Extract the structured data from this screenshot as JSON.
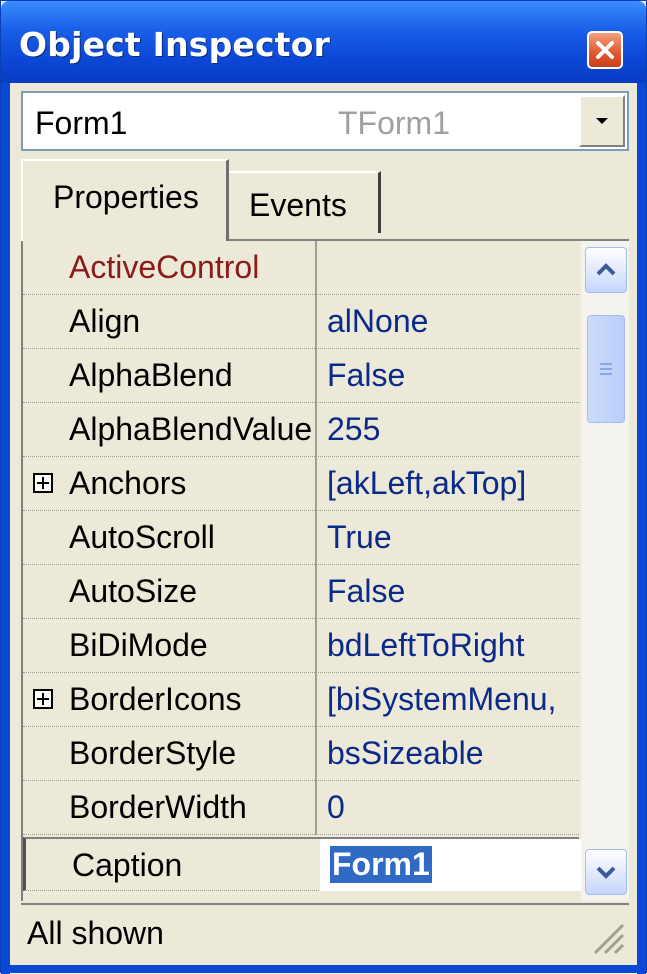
{
  "window": {
    "title": "Object Inspector"
  },
  "selector": {
    "name": "Form1",
    "type": "TForm1"
  },
  "tabs": [
    {
      "label": "Properties",
      "active": true
    },
    {
      "label": "Events",
      "active": false
    }
  ],
  "properties": [
    {
      "name": "ActiveControl",
      "value": "",
      "expandable": false,
      "name_color": "#8b1a1a"
    },
    {
      "name": "Align",
      "value": "alNone",
      "expandable": false
    },
    {
      "name": "AlphaBlend",
      "value": "False",
      "expandable": false
    },
    {
      "name": "AlphaBlendValue",
      "value": "255",
      "expandable": false
    },
    {
      "name": "Anchors",
      "value": "[akLeft,akTop]",
      "expandable": true
    },
    {
      "name": "AutoScroll",
      "value": "True",
      "expandable": false
    },
    {
      "name": "AutoSize",
      "value": "False",
      "expandable": false
    },
    {
      "name": "BiDiMode",
      "value": "bdLeftToRight",
      "expandable": false
    },
    {
      "name": "BorderIcons",
      "value": "[biSystemMenu,",
      "expandable": true
    },
    {
      "name": "BorderStyle",
      "value": "bsSizeable",
      "expandable": false
    },
    {
      "name": "BorderWidth",
      "value": "0",
      "expandable": false
    },
    {
      "name": "Caption",
      "value": "Form1",
      "expandable": false,
      "selected": true
    }
  ],
  "status": {
    "text": "All shown"
  },
  "colors": {
    "titlebar": "#0b48d6",
    "face": "#ece9d8",
    "value_text": "#0a2a8a",
    "selection": "#316ac5"
  }
}
